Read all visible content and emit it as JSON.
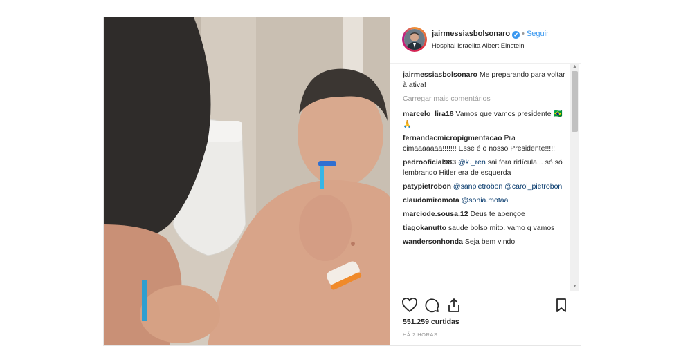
{
  "post": {
    "username": "jairmessiasbolsonaro",
    "follow_label": "Seguir",
    "separator": "•",
    "verified_glyph": "✔",
    "location": "Hospital Israelita Albert Einstein",
    "caption": {
      "user": "jairmessiasbolsonaro",
      "text": "Me preparando para voltar à ativa!"
    },
    "load_more": "Carregar mais comentários",
    "comments": [
      {
        "user": "marcelo_lira18",
        "text": "Vamos que vamos presidente 🇧🇷🙏"
      },
      {
        "user": "fernandacmicropigmentacao",
        "text": "Pra cimaaaaaaa!!!!!!! Esse é o nosso Presidente!!!!!"
      },
      {
        "user": "pedrooficial983",
        "mention": "@k._ren",
        "text": "sai fora ridícula... só só lembrando Hitler era de esquerda"
      },
      {
        "user": "patypietrobon",
        "mention": "@sanpietrobon",
        "mention2": "@carol_pietrobon"
      },
      {
        "user": "claudomiromota",
        "mention": "@sonia.motaa"
      },
      {
        "user": "marciode.sousa.12",
        "text": "Deus te abençoe"
      },
      {
        "user": "tiagokanutto",
        "text": "saude bolso mito. vamo q vamos"
      },
      {
        "user": "wandersonhonda",
        "text": "Seja bem vindo"
      }
    ],
    "likes": "551.259 curtidas",
    "time": "HÁ 2 HORAS",
    "icons": [
      "heart-icon",
      "comment-icon",
      "share-icon",
      "bookmark-icon"
    ],
    "colors": {
      "link": "#3897f0",
      "verified": "#3897f0",
      "muted": "#999999",
      "text": "#262626"
    },
    "scrollbar": {
      "up_glyph": "▲",
      "down_glyph": "▼"
    }
  }
}
